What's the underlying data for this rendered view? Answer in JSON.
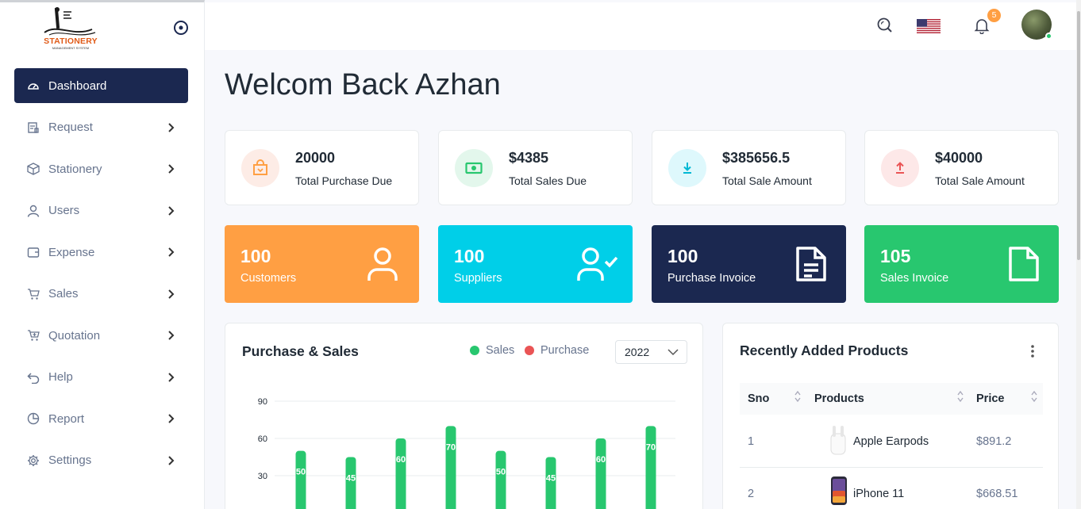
{
  "sidebar": {
    "logo_text": "STATIONERY",
    "logo_subtext": "MANAGEMENT SYSTEM",
    "items": [
      {
        "label": "Dashboard",
        "icon": "dashboard-icon"
      },
      {
        "label": "Request",
        "icon": "request-icon"
      },
      {
        "label": "Stationery",
        "icon": "box-icon"
      },
      {
        "label": "Users",
        "icon": "user-icon"
      },
      {
        "label": "Expense",
        "icon": "wallet-icon"
      },
      {
        "label": "Sales",
        "icon": "cart-icon"
      },
      {
        "label": "Quotation",
        "icon": "cart-plus-icon"
      },
      {
        "label": "Help",
        "icon": "undo-icon"
      },
      {
        "label": "Report",
        "icon": "pie-chart-icon"
      },
      {
        "label": "Settings",
        "icon": "gear-icon"
      }
    ]
  },
  "topbar": {
    "notification_count": "5"
  },
  "welcome": "Welcom Back Azhan",
  "stats": [
    {
      "value": "20000",
      "label": "Total Purchase Due",
      "icon": "shopping-bag-icon",
      "color": "#ff9f43",
      "bg": "#fdece6"
    },
    {
      "value": "$4385",
      "label": "Total Sales Due",
      "icon": "cash-icon",
      "color": "#28c76f",
      "bg": "#e3f7ec"
    },
    {
      "value": "$385656.5",
      "label": "Total Sale Amount",
      "icon": "download-icon",
      "color": "#00cfe8",
      "bg": "#def8fc"
    },
    {
      "value": "$40000",
      "label": "Total Sale Amount",
      "icon": "upload-icon",
      "color": "#ea5455",
      "bg": "#fde8e8"
    }
  ],
  "tiles": [
    {
      "value": "100",
      "label": "Customers",
      "icon": "user-icon",
      "color": "#ff9f43"
    },
    {
      "value": "100",
      "label": "Suppliers",
      "icon": "user-check-icon",
      "color": "#00cfe8"
    },
    {
      "value": "100",
      "label": "Purchase Invoice",
      "icon": "file-text-icon",
      "color": "#1b2850"
    },
    {
      "value": "105",
      "label": "Sales Invoice",
      "icon": "file-icon",
      "color": "#28c76f"
    }
  ],
  "purchase_sales": {
    "title": "Purchase & Sales",
    "legend_sales": "Sales",
    "legend_purchase": "Purchase",
    "year": "2022",
    "sales_color": "#28c76f",
    "purchase_color": "#ea5455"
  },
  "chart_data": {
    "type": "bar",
    "title": "Purchase & Sales",
    "yticks": [
      30,
      60,
      90
    ],
    "ylim": [
      0,
      90
    ],
    "series": [
      {
        "name": "Sales",
        "values": [
          50,
          45,
          60,
          70,
          50,
          45,
          60,
          70
        ]
      }
    ]
  },
  "products": {
    "title": "Recently Added Products",
    "columns": [
      "Sno",
      "Products",
      "Price"
    ],
    "rows": [
      {
        "sno": "1",
        "name": "Apple Earpods",
        "price": "$891.2",
        "icon": "earpods-icon"
      },
      {
        "sno": "2",
        "name": "iPhone 11",
        "price": "$668.51",
        "icon": "iphone-icon"
      }
    ]
  }
}
